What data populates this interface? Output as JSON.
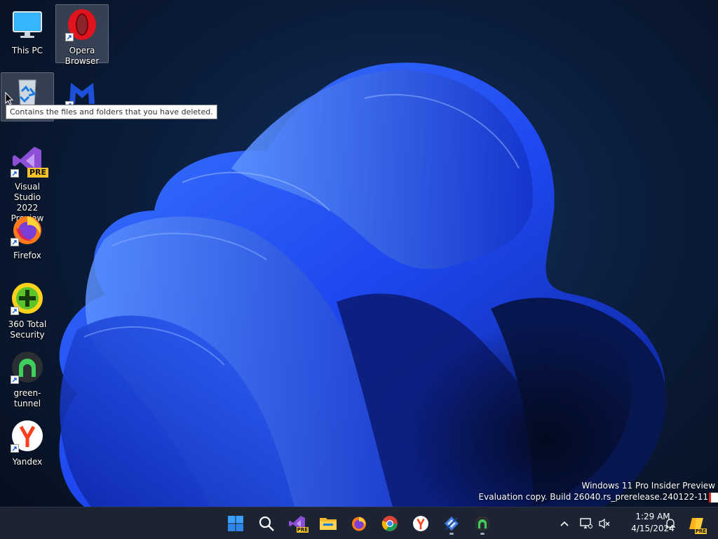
{
  "desktop": {
    "icons": [
      {
        "id": "this-pc",
        "label": "This PC"
      },
      {
        "id": "opera",
        "label": "Opera\nBrowser"
      },
      {
        "id": "recycle-bin",
        "label": "Recycle Bin"
      },
      {
        "id": "malwarebytes",
        "label": "Malwarebytes"
      },
      {
        "id": "visual-studio",
        "label": "Visual Studio\n2022 Preview",
        "badge": "PRE"
      },
      {
        "id": "firefox",
        "label": "Firefox"
      },
      {
        "id": "360-security",
        "label": "360 Total\nSecurity"
      },
      {
        "id": "green-tunnel",
        "label": "green-tunnel"
      },
      {
        "id": "yandex",
        "label": "Yandex"
      }
    ],
    "tooltip": "Contains the files and folders that you have deleted."
  },
  "watermark": {
    "line1": "Windows 11 Pro Insider Preview",
    "line2": "Evaluation copy. Build 26040.rs_prerelease.240122-11"
  },
  "taskbar": {
    "pinned": [
      "Start",
      "Search",
      "Visual Studio 2022 Preview",
      "File Explorer",
      "Firefox",
      "Google Chrome",
      "Yandex",
      "Network tool",
      "green-tunnel"
    ],
    "vs_badge": "PRE",
    "clock": {
      "time": "1:29 AM",
      "date": "4/15/2024"
    },
    "tray_badge": "PRE"
  },
  "colors": {
    "taskbar_bg": "#1c2333",
    "wallpaper_blue": "#1f4fff",
    "accent": "#4cc2ff"
  }
}
